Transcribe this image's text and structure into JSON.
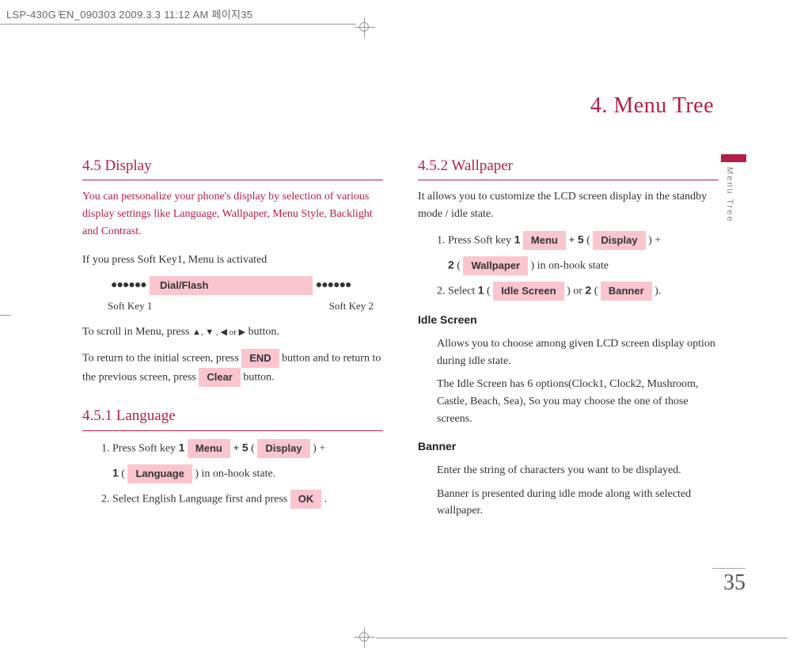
{
  "header": {
    "strip": "LSP-430G EN_090303  2009.3.3 11:12 AM  페이지35"
  },
  "chapter": {
    "title": "4. Menu Tree",
    "side_label": "Menu Tree"
  },
  "left": {
    "h_display": "4.5 Display",
    "intro": "You can personalize your phone's display by selection of various display settings like Language, Wallpaper, Menu Style, Backlight and Contrast.",
    "p_softkey_intro": "If you press Soft Key1, Menu is activated",
    "softbar": {
      "dots": "●●●●●●",
      "dialflash_label": "Dial/Flash",
      "sk1": "Soft Key 1",
      "sk2": "Soft Key 2"
    },
    "p_scroll_a": "To scroll in Menu, press ",
    "p_scroll_b": " button.",
    "arrows_text": "▲, ▼ , ◀ or ▶",
    "p_return_a": "To return to the initial screen, press ",
    "p_return_b": " button and to return to the previous screen, press ",
    "p_return_c": " button.",
    "btn_end": "END",
    "btn_clear": "Clear",
    "h_language": "4.5.1 Language",
    "lang": {
      "line1_a": "1. Press Soft key ",
      "n1": "1",
      "btn_menu": "Menu",
      "plus5": " + ",
      "n5": "5",
      "paren_open": " ( ",
      "btn_display": "Display",
      "paren_close_plus": " ) +",
      "line2_n1": "1",
      "btn_language": "Language",
      "line2_tail": " ) in on-hook state.",
      "line3_a": "2. Select English Language first and press ",
      "btn_ok": "OK",
      "period": " ."
    }
  },
  "right": {
    "h_wallpaper": "4.5.2 Wallpaper",
    "p_wall_intro": "It allows you to customize the LCD screen display in the standby mode / idle state.",
    "w": {
      "line1_a": "1. Press Soft key ",
      "n1": "1",
      "btn_menu": "Menu",
      "plus": " + ",
      "n5": "5",
      "btn_display": "Display",
      "close_plus": " ) +",
      "line2_n2": "2",
      "btn_wallpaper": "Wallpaper",
      "line2_tail": " ) in on-hook state",
      "line3_a": "2. Select ",
      "s_n1": "1",
      "btn_idle": "Idle Screen",
      "or": " ) or ",
      "s_n2": "2",
      "btn_banner": "Banner",
      "tail": " )."
    },
    "sub_idle": "Idle Screen",
    "idle_p1": "Allows you to choose among given LCD screen display option during idle state.",
    "idle_p2": "The Idle Screen has 6 options(Clock1, Clock2, Mushroom, Castle, Beach, Sea), So you may choose the one of those screens.",
    "sub_banner": "Banner",
    "banner_p1": "Enter the string of characters you want to be displayed.",
    "banner_p2": "Banner is presented during idle mode along with selected wallpaper."
  },
  "page_number": "35"
}
